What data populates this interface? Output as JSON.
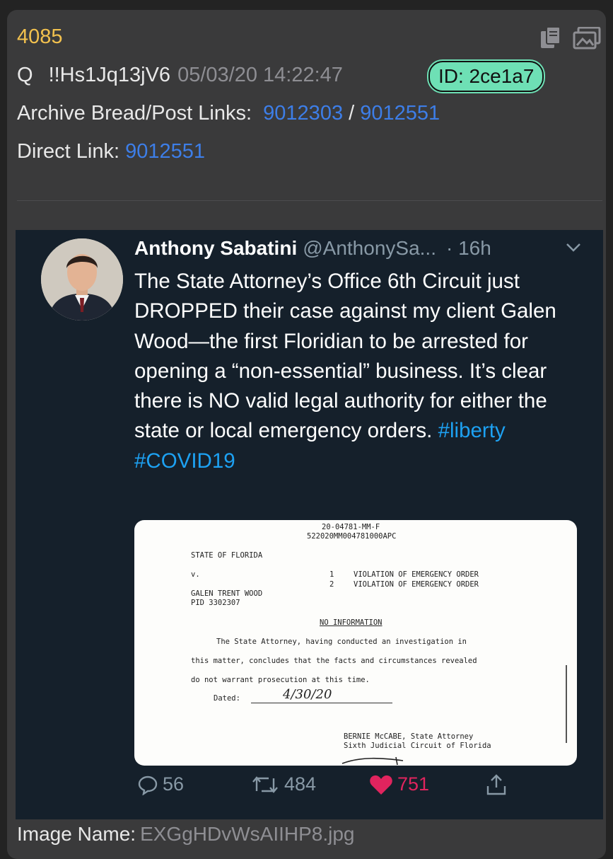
{
  "post": {
    "number": "4085",
    "name": "Q",
    "tripcode": "!!Hs1Jq13jV6",
    "datetime": "05/03/20 14:22:47",
    "id_badge": "ID: 2ce1a7",
    "archive_label": "Archive Bread/Post Links:",
    "archive_link1": "9012303",
    "archive_sep": "/",
    "archive_link2": "9012551",
    "direct_label": "Direct Link:",
    "direct_link": "9012551",
    "image_label": "Image Name:",
    "image_filename": "EXGgHDvWsAIIHP8.jpg"
  },
  "tweet": {
    "author_name": "Anthony Sabatini",
    "handle": "@AnthonySa...",
    "time": "· 16h",
    "text": "The State Attorney’s Office 6th Circuit just DROPPED their case against my client Galen Wood—the first Floridian to be arrested for opening a “non-essential” business.  It’s clear there is NO valid legal authority for either the state or local emergency orders. ",
    "hashtag1": "#liberty",
    "hashtag2": "#COVID19",
    "replies": "56",
    "retweets": "484",
    "likes": "751",
    "document": {
      "case_number": "20-04781-MM-F",
      "case_code": "522020MM004781000APC",
      "state": "STATE OF FLORIDA",
      "versus": "v.",
      "count1_num": "1",
      "count1": "VIOLATION OF EMERGENCY ORDER",
      "count2_num": "2",
      "count2": "VIOLATION OF EMERGENCY ORDER",
      "defendant": "GALEN TRENT WOOD",
      "pid": "PID 3302307",
      "heading": "NO INFORMATION",
      "para1": "The State Attorney, having conducted an investigation in",
      "para2": "this matter, concludes that the facts and circumstances revealed",
      "para3": "do not warrant prosecution at this time.",
      "dated_label": "Dated:",
      "dated_value": "4/30/20",
      "signer": "BERNIE McCABE, State Attorney",
      "signer_office": "Sixth Judicial Circuit of Florida"
    }
  },
  "colors": {
    "post_number": "#f2c14e",
    "link": "#3d7ee8",
    "id_badge": "#6ee0b5",
    "tweet_bg": "#15202b",
    "hashtag": "#1da1f2",
    "like": "#e0245e"
  }
}
